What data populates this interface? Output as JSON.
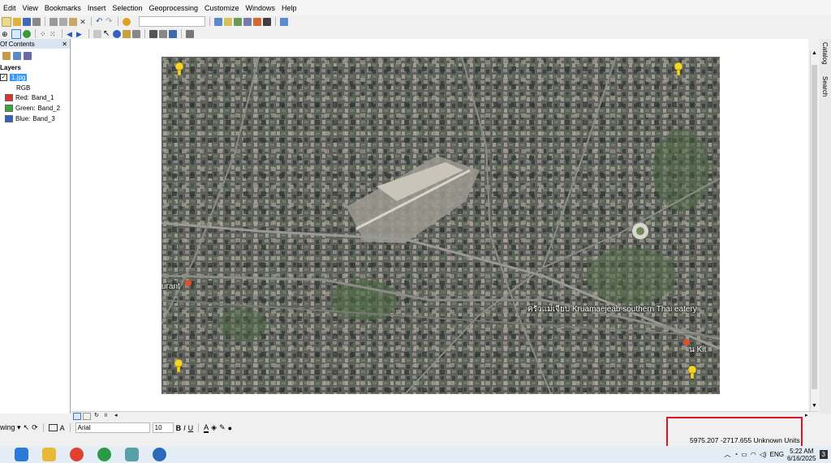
{
  "menu": [
    "Edit",
    "View",
    "Bookmarks",
    "Insert",
    "Selection",
    "Geoprocessing",
    "Customize",
    "Windows",
    "Help"
  ],
  "toc": {
    "title": "Of Contents",
    "pin": "✕",
    "layers_label": "Layers",
    "layer_name": "1.jpg",
    "rgb_label": "RGB",
    "bands": [
      {
        "label": "Red:",
        "band": "Band_1",
        "color": "#e03030"
      },
      {
        "label": "Green:",
        "band": "Band_2",
        "color": "#38a838"
      },
      {
        "label": "Blue:",
        "band": "Band_3",
        "color": "#3060c8"
      }
    ]
  },
  "map": {
    "labels": {
      "restaurant_left": "urant",
      "thai_eatery": "ครัวแม่เจียบ Kruamaejeab southern Thai eatery",
      "kitchen_right": "น Kit"
    }
  },
  "dock": {
    "catalog": "Catalog",
    "search": "Search"
  },
  "draw_toolbar": {
    "drawing_label": "wing ▾",
    "font_name": "Arial",
    "font_size": "10",
    "bold": "B",
    "italic": "I",
    "underline": "U",
    "font_color": "A"
  },
  "status": {
    "x": "5975.207",
    "y": "-2717.655",
    "units": "Unknown Units"
  },
  "taskbar": {
    "time": "5:22 AM",
    "date": "6/16/2025",
    "lang": "ENG",
    "notif_count": "3"
  },
  "colors": {
    "highlight_box": "#e0141e",
    "selected_layer": "#3399ff"
  }
}
